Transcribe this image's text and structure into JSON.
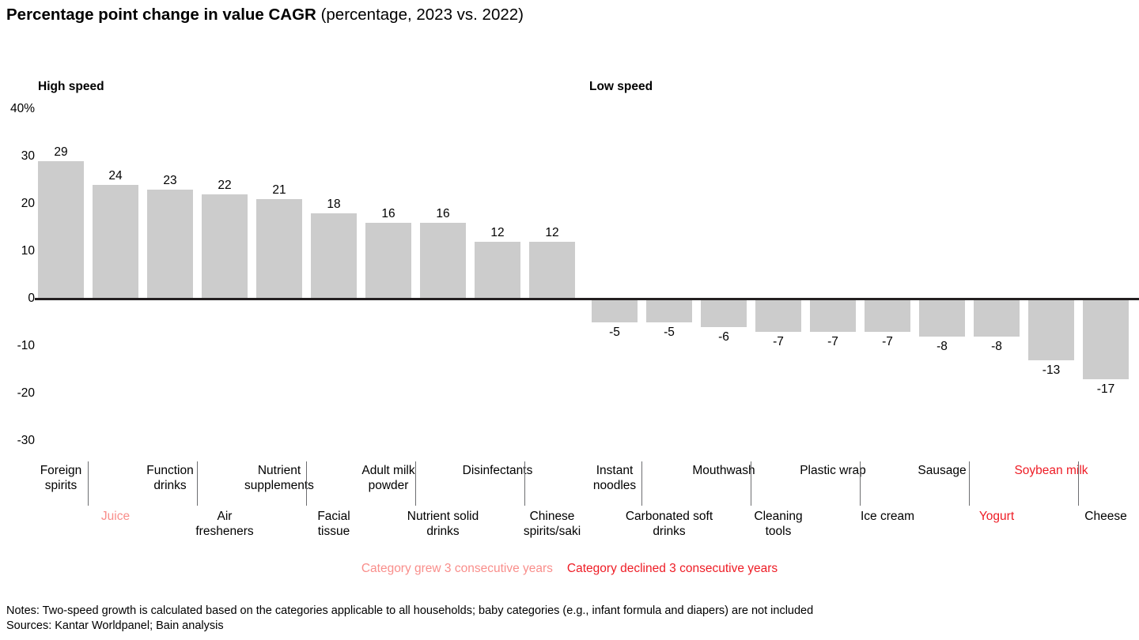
{
  "title": {
    "bold": "Percentage point change in value CAGR",
    "regular": " (percentage, 2023 vs. 2022)"
  },
  "sections": {
    "high_speed": "High speed",
    "low_speed": "Low speed"
  },
  "legend": {
    "grew": "Category grew 3 consecutive years",
    "declined": "Category declined 3 consecutive years",
    "grew_color": "#f98e8b",
    "declined_color": "#ee1c25"
  },
  "footnotes": {
    "notes": "Notes: Two-speed growth is calculated based on the categories applicable to all households; baby categories (e.g., infant formula and diapers) are not included",
    "sources": "Sources: Kantar Worldpanel; Bain analysis"
  },
  "chart_data": {
    "type": "bar",
    "title": "Percentage point change in value CAGR (percentage, 2023 vs. 2022)",
    "xlabel": "",
    "ylabel": "",
    "ylim": [
      -30,
      40
    ],
    "yticks": [
      40,
      30,
      20,
      10,
      0,
      -10,
      -20,
      -30
    ],
    "ytick_labels": [
      "40%",
      "30",
      "20",
      "10",
      "0",
      "-10",
      "-20",
      "-30"
    ],
    "grid": false,
    "legend_position": "bottom-center",
    "bar_color": "#cccccc",
    "groups": [
      {
        "name": "High speed",
        "start_index": 0,
        "end_index": 9
      },
      {
        "name": "Low speed",
        "start_index": 10,
        "end_index": 19
      }
    ],
    "categories": [
      "Foreign spirits",
      "Juice",
      "Function drinks",
      "Air fresheners",
      "Nutrient supplements",
      "Facial tissue",
      "Adult milk powder",
      "Nutrient solid drinks",
      "Disinfectants",
      "Chinese spirits/saki",
      "Instant noodles",
      "Carbonated soft drinks",
      "Mouthwash",
      "Cleaning tools",
      "Plastic wrap",
      "Ice cream",
      "Sausage",
      "Yogurt",
      "Soybean milk",
      "Cheese"
    ],
    "values": [
      29,
      24,
      23,
      22,
      21,
      18,
      16,
      16,
      12,
      12,
      -5,
      -5,
      -6,
      -7,
      -7,
      -7,
      -8,
      -8,
      -13,
      -17
    ],
    "value_labels": [
      "29",
      "24",
      "23",
      "22",
      "21",
      "18",
      "16",
      "16",
      "12",
      "12",
      "-5",
      "-5",
      "-6",
      "-7",
      "-7",
      "-7",
      "-8",
      "-8",
      "-13",
      "-17"
    ],
    "category_highlight": [
      "none",
      "grew",
      "none",
      "none",
      "none",
      "none",
      "none",
      "none",
      "none",
      "none",
      "none",
      "none",
      "none",
      "none",
      "none",
      "none",
      "none",
      "declined",
      "declined",
      "none"
    ]
  }
}
